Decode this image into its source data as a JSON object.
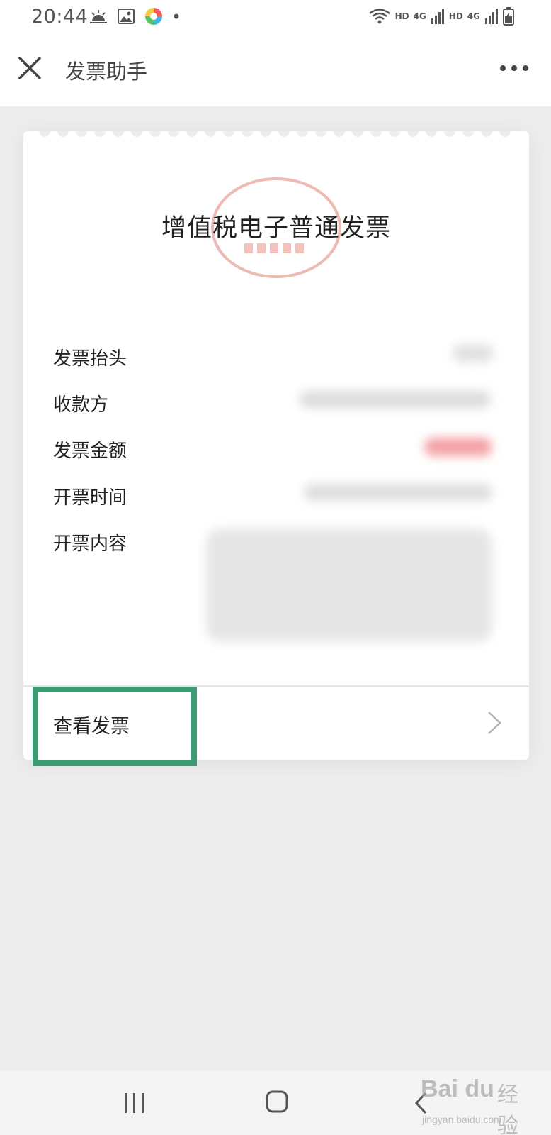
{
  "status_bar": {
    "time": "20:44",
    "icons_left": [
      "weather-icon",
      "gallery-icon",
      "app-icon",
      "dot-icon"
    ],
    "hd_label_1": "HD",
    "hd_label_2": "HD",
    "network_label_1": "4G",
    "network_label_2": "4G"
  },
  "title_bar": {
    "title": "发票助手"
  },
  "invoice": {
    "title": "增值税电子普通发票",
    "fields": [
      {
        "label": "发票抬头"
      },
      {
        "label": "收款方"
      },
      {
        "label": "发票金额"
      },
      {
        "label": "开票时间"
      },
      {
        "label": "开票内容"
      }
    ],
    "view_label": "查看发票"
  },
  "watermark": {
    "brand": "Bai du",
    "sub": "经验",
    "url": "jingyan.baidu.com"
  },
  "colors": {
    "highlight": "#3b9b72",
    "seal": "#e7a39b",
    "amount_blur": "#f4a2a6"
  }
}
